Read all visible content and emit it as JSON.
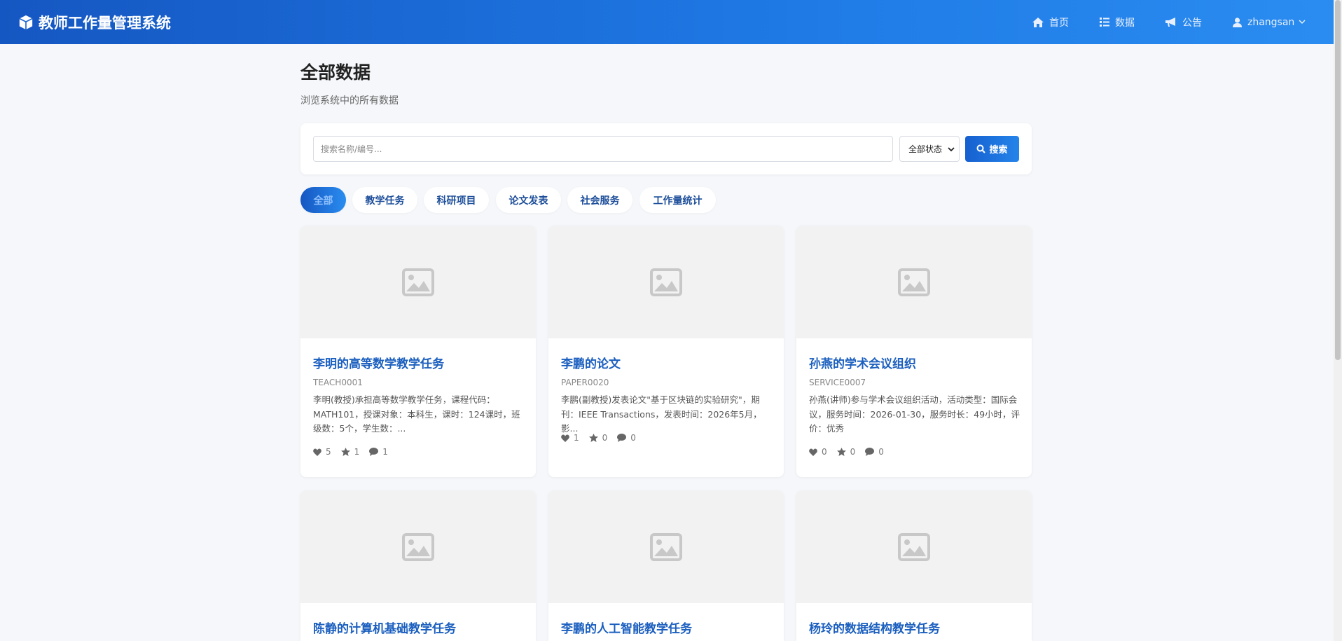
{
  "app": {
    "title": "教师工作量管理系统"
  },
  "nav": {
    "home": "首页",
    "data": "数据",
    "notice": "公告",
    "user": "zhangsan"
  },
  "page": {
    "title": "全部数据",
    "subtitle": "浏览系统中的所有数据"
  },
  "search": {
    "placeholder": "搜索名称/编号...",
    "status_selected": "全部状态",
    "button": "搜索"
  },
  "tabs": [
    "全部",
    "教学任务",
    "科研项目",
    "论文发表",
    "社会服务",
    "工作量统计"
  ],
  "cards": [
    {
      "title": "李明的高等数学教学任务",
      "code": "TEACH0001",
      "desc": "李明(教授)承担高等数学教学任务，课程代码：MATH101，授课对象：本科生，课时：124课时，班级数：5个，学生数：...",
      "likes": "5",
      "favorites": "1",
      "comments": "1"
    },
    {
      "title": "李鹏的论文",
      "code": "PAPER0020",
      "desc": "李鹏(副教授)发表论文\"基于区块链的实验研究\"，期刊：IEEE Transactions，发表时间：2026年5月，影...",
      "likes": "1",
      "favorites": "0",
      "comments": "0"
    },
    {
      "title": "孙燕的学术会议组织",
      "code": "SERVICE0007",
      "desc": "孙燕(讲师)参与学术会议组织活动，活动类型：国际会议，服务时间：2026-01-30，服务时长：49小时，评价：优秀",
      "likes": "0",
      "favorites": "0",
      "comments": "0"
    },
    {
      "title": "陈静的计算机基础教学任务"
    },
    {
      "title": "李鹏的人工智能教学任务"
    },
    {
      "title": "杨玲的数据结构教学任务"
    }
  ],
  "icons": {
    "brand": "cube-icon",
    "home": "home-icon",
    "data": "list-icon",
    "notice": "bullhorn-icon",
    "user": "user-icon",
    "placeholder": "image-icon",
    "like": "heart-icon",
    "favorite": "star-icon",
    "comment": "comment-icon"
  },
  "colors": {
    "header_start": "#1557c2",
    "header_end": "#2a8cf0",
    "title_blue": "#1b5fbf",
    "background": "#f5f7fa"
  }
}
